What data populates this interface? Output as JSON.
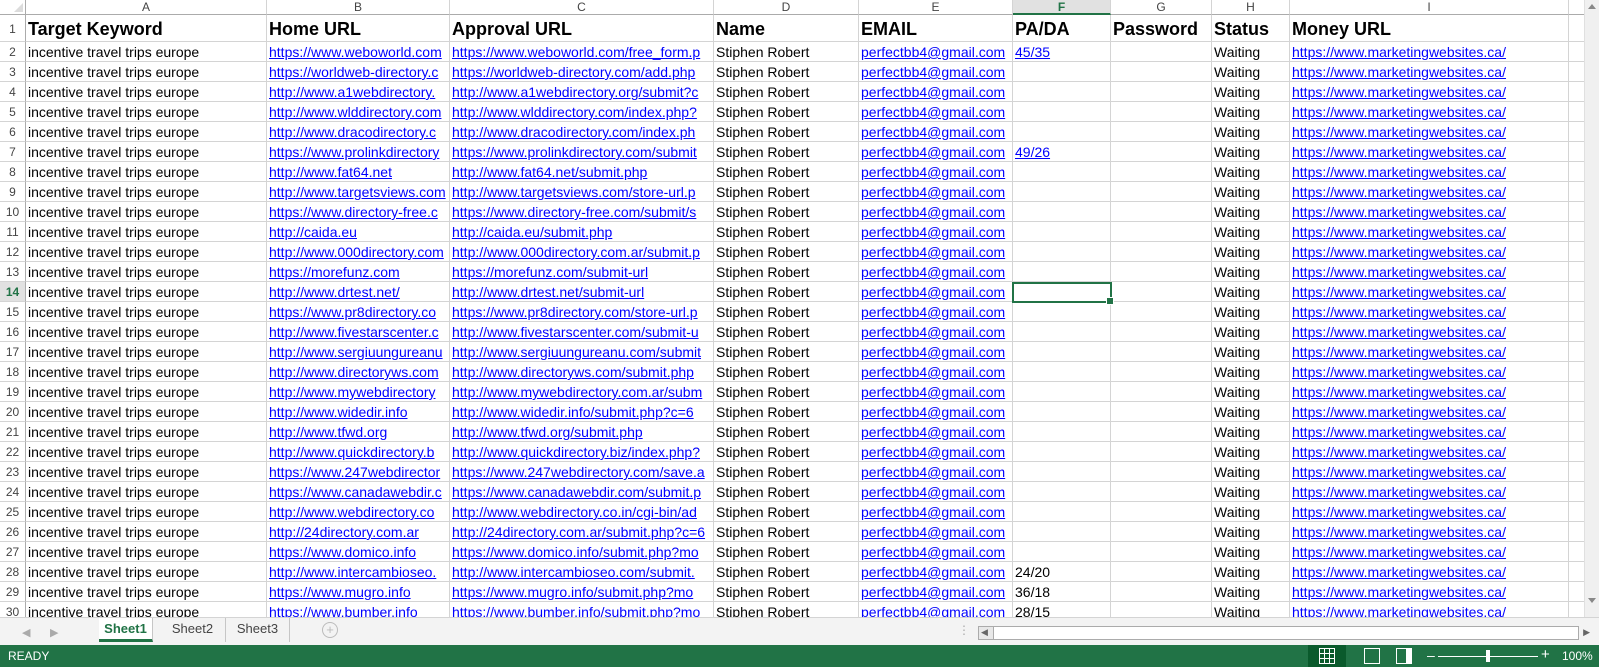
{
  "columns": [
    "A",
    "B",
    "C",
    "D",
    "E",
    "F",
    "G",
    "H",
    "I"
  ],
  "headers": [
    "Target Keyword",
    "Home URL",
    "Approval URL",
    "Name",
    "EMAIL",
    "PA/DA",
    "Password",
    "Status",
    "Money URL"
  ],
  "selected_cell": "F14",
  "rows": [
    {
      "n": "2",
      "a": "incentive travel trips europe",
      "b": "https://www.weboworld.com",
      "c": "https://www.weboworld.com/free_form.p",
      "d": "Stiphen Robert",
      "e": "perfectbb4@gmail.com",
      "f": "45/35",
      "f_link": true,
      "h": "Waiting",
      "i": "https://www.marketingwebsites.ca/"
    },
    {
      "n": "3",
      "a": "incentive travel trips europe",
      "b": "https://worldweb-directory.c",
      "c": "https://worldweb-directory.com/add.php",
      "d": "Stiphen Robert",
      "e": "perfectbb4@gmail.com",
      "f": "",
      "h": "Waiting",
      "i": "https://www.marketingwebsites.ca/"
    },
    {
      "n": "4",
      "a": "incentive travel trips europe",
      "b": "http://www.a1webdirectory.",
      "c": "http://www.a1webdirectory.org/submit?c",
      "d": "Stiphen Robert",
      "e": "perfectbb4@gmail.com",
      "f": "",
      "h": "Waiting",
      "i": "https://www.marketingwebsites.ca/"
    },
    {
      "n": "5",
      "a": "incentive travel trips europe",
      "b": "http://www.wlddirectory.com",
      "c": "http://www.wlddirectory.com/index.php?",
      "d": "Stiphen Robert",
      "e": "perfectbb4@gmail.com",
      "f": "",
      "h": "Waiting",
      "i": "https://www.marketingwebsites.ca/"
    },
    {
      "n": "6",
      "a": "incentive travel trips europe",
      "b": "http://www.dracodirectory.c",
      "c": "http://www.dracodirectory.com/index.ph",
      "d": "Stiphen Robert",
      "e": "perfectbb4@gmail.com",
      "f": "",
      "h": "Waiting",
      "i": "https://www.marketingwebsites.ca/"
    },
    {
      "n": "7",
      "a": "incentive travel trips europe",
      "b": "https://www.prolinkdirectory",
      "c": "https://www.prolinkdirectory.com/submit",
      "d": "Stiphen Robert",
      "e": "perfectbb4@gmail.com",
      "f": "49/26",
      "f_link": true,
      "h": "Waiting",
      "i": "https://www.marketingwebsites.ca/"
    },
    {
      "n": "8",
      "a": "incentive travel trips europe",
      "b": "http://www.fat64.net",
      "c": "http://www.fat64.net/submit.php",
      "d": "Stiphen Robert",
      "e": "perfectbb4@gmail.com",
      "f": "",
      "h": "Waiting",
      "i": "https://www.marketingwebsites.ca/"
    },
    {
      "n": "9",
      "a": "incentive travel trips europe",
      "b": "http://www.targetsviews.com",
      "c": "http://www.targetsviews.com/store-url.p",
      "d": "Stiphen Robert",
      "e": "perfectbb4@gmail.com",
      "f": "",
      "h": "Waiting",
      "i": "https://www.marketingwebsites.ca/"
    },
    {
      "n": "10",
      "a": "incentive travel trips europe",
      "b": "https://www.directory-free.c",
      "c": "https://www.directory-free.com/submit/s",
      "d": "Stiphen Robert",
      "e": "perfectbb4@gmail.com",
      "f": "",
      "h": "Waiting",
      "i": "https://www.marketingwebsites.ca/"
    },
    {
      "n": "11",
      "a": "incentive travel trips europe",
      "b": "http://caida.eu",
      "c": "http://caida.eu/submit.php",
      "d": "Stiphen Robert",
      "e": "perfectbb4@gmail.com",
      "f": "",
      "h": "Waiting",
      "i": "https://www.marketingwebsites.ca/"
    },
    {
      "n": "12",
      "a": "incentive travel trips europe",
      "b": "http://www.000directory.com",
      "c": "http://www.000directory.com.ar/submit.p",
      "d": "Stiphen Robert",
      "e": "perfectbb4@gmail.com",
      "f": "",
      "h": "Waiting",
      "i": "https://www.marketingwebsites.ca/"
    },
    {
      "n": "13",
      "a": "incentive travel trips europe",
      "b": "https://morefunz.com",
      "c": "https://morefunz.com/submit-url",
      "d": "Stiphen Robert",
      "e": "perfectbb4@gmail.com",
      "f": "",
      "h": "Waiting",
      "i": "https://www.marketingwebsites.ca/"
    },
    {
      "n": "14",
      "a": "incentive travel trips europe",
      "b": "http://www.drtest.net/",
      "c": "http://www.drtest.net/submit-url",
      "d": "Stiphen Robert",
      "e": "perfectbb4@gmail.com",
      "f": "",
      "h": "Waiting",
      "i": "https://www.marketingwebsites.ca/"
    },
    {
      "n": "15",
      "a": "incentive travel trips europe",
      "b": "https://www.pr8directory.co",
      "c": "https://www.pr8directory.com/store-url.p",
      "d": "Stiphen Robert",
      "e": "perfectbb4@gmail.com",
      "f": "",
      "h": "Waiting",
      "i": "https://www.marketingwebsites.ca/"
    },
    {
      "n": "16",
      "a": "incentive travel trips europe",
      "b": "http://www.fivestarscenter.c",
      "c": "http://www.fivestarscenter.com/submit-u",
      "d": "Stiphen Robert",
      "e": "perfectbb4@gmail.com",
      "f": "",
      "h": "Waiting",
      "i": "https://www.marketingwebsites.ca/"
    },
    {
      "n": "17",
      "a": "incentive travel trips europe",
      "b": "http://www.sergiuungureanu",
      "c": "http://www.sergiuungureanu.com/submit",
      "d": "Stiphen Robert",
      "e": "perfectbb4@gmail.com",
      "f": "",
      "h": "Waiting",
      "i": "https://www.marketingwebsites.ca/"
    },
    {
      "n": "18",
      "a": "incentive travel trips europe",
      "b": "http://www.directoryws.com",
      "c": "http://www.directoryws.com/submit.php",
      "d": "Stiphen Robert",
      "e": "perfectbb4@gmail.com",
      "f": "",
      "h": "Waiting",
      "i": "https://www.marketingwebsites.ca/"
    },
    {
      "n": "19",
      "a": "incentive travel trips europe",
      "b": "http://www.mywebdirectory",
      "c": "http://www.mywebdirectory.com.ar/subm",
      "d": "Stiphen Robert",
      "e": "perfectbb4@gmail.com",
      "f": "",
      "h": "Waiting",
      "i": "https://www.marketingwebsites.ca/"
    },
    {
      "n": "20",
      "a": "incentive travel trips europe",
      "b": "http://www.widedir.info",
      "c": "http://www.widedir.info/submit.php?c=6",
      "d": "Stiphen Robert",
      "e": "perfectbb4@gmail.com",
      "f": "",
      "h": "Waiting",
      "i": "https://www.marketingwebsites.ca/"
    },
    {
      "n": "21",
      "a": "incentive travel trips europe",
      "b": "http://www.tfwd.org",
      "c": "http://www.tfwd.org/submit.php",
      "d": "Stiphen Robert",
      "e": "perfectbb4@gmail.com",
      "f": "",
      "h": "Waiting",
      "i": "https://www.marketingwebsites.ca/"
    },
    {
      "n": "22",
      "a": "incentive travel trips europe",
      "b": "http://www.quickdirectory.b",
      "c": "http://www.quickdirectory.biz/index.php?",
      "d": "Stiphen Robert",
      "e": "perfectbb4@gmail.com",
      "f": "",
      "h": "Waiting",
      "i": "https://www.marketingwebsites.ca/"
    },
    {
      "n": "23",
      "a": "incentive travel trips europe",
      "b": "https://www.247webdirector",
      "c": "https://www.247webdirectory.com/save.a",
      "d": "Stiphen Robert",
      "e": "perfectbb4@gmail.com",
      "f": "",
      "h": "Waiting",
      "i": "https://www.marketingwebsites.ca/"
    },
    {
      "n": "24",
      "a": "incentive travel trips europe",
      "b": "https://www.canadawebdir.c",
      "c": "https://www.canadawebdir.com/submit.p",
      "d": "Stiphen Robert",
      "e": "perfectbb4@gmail.com",
      "f": "",
      "h": "Waiting",
      "i": "https://www.marketingwebsites.ca/"
    },
    {
      "n": "25",
      "a": "incentive travel trips europe",
      "b": "http://www.webdirectory.co",
      "c": "http://www.webdirectory.co.in/cgi-bin/ad",
      "d": "Stiphen Robert",
      "e": "perfectbb4@gmail.com",
      "f": "",
      "h": "Waiting",
      "i": "https://www.marketingwebsites.ca/"
    },
    {
      "n": "26",
      "a": "incentive travel trips europe",
      "b": "http://24directory.com.ar",
      "c": "http://24directory.com.ar/submit.php?c=6",
      "d": "Stiphen Robert",
      "e": "perfectbb4@gmail.com",
      "f": "",
      "h": "Waiting",
      "i": "https://www.marketingwebsites.ca/"
    },
    {
      "n": "27",
      "a": "incentive travel trips europe",
      "b": "https://www.domico.info",
      "c": "https://www.domico.info/submit.php?mo",
      "d": "Stiphen Robert",
      "e": "perfectbb4@gmail.com",
      "f": "",
      "h": "Waiting",
      "i": "https://www.marketingwebsites.ca/"
    },
    {
      "n": "28",
      "a": "incentive travel trips europe",
      "b": "http://www.intercambioseo.",
      "c": "http://www.intercambioseo.com/submit.",
      "d": "Stiphen Robert",
      "e": "perfectbb4@gmail.com",
      "f": "24/20",
      "h": "Waiting",
      "i": "https://www.marketingwebsites.ca/"
    },
    {
      "n": "29",
      "a": "incentive travel trips europe",
      "b": "https://www.mugro.info",
      "c": "https://www.mugro.info/submit.php?mo",
      "d": "Stiphen Robert",
      "e": "perfectbb4@gmail.com",
      "f": "36/18",
      "h": "Waiting",
      "i": "https://www.marketingwebsites.ca/"
    },
    {
      "n": "30",
      "a": "incentive travel trips europe",
      "b": "https://www.bumber.info",
      "c": "https://www.bumber.info/submit.php?mo",
      "d": "Stiphen Robert",
      "e": "perfectbb4@gmail.com",
      "f": "28/15",
      "h": "Waiting",
      "i": "https://www.marketingwebsites.ca/"
    }
  ],
  "sheets": [
    "Sheet1",
    "Sheet2",
    "Sheet3"
  ],
  "active_sheet": "Sheet1",
  "status": {
    "mode": "READY",
    "zoom": "100%",
    "zoom_level": 100
  },
  "colors": {
    "accent": "#217346",
    "link": "#0000ff",
    "grid": "#d4d4d4"
  }
}
